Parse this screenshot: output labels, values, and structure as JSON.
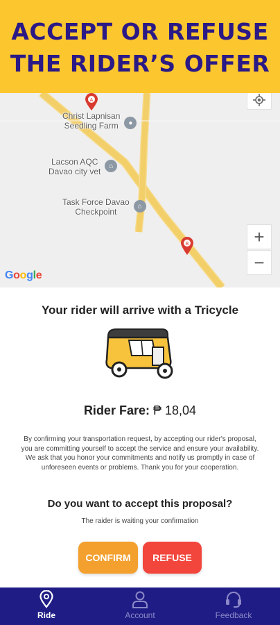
{
  "banner": {
    "line1": "ACCEPT OR REFUSE",
    "line2": "THE RIDER’S OFFER"
  },
  "map": {
    "pois": [
      {
        "name": "Christ Lapnisan\nSeedling Farm"
      },
      {
        "name": "Lacson AQC\nDavao city vet"
      },
      {
        "name": "Task Force Davao\nCheckpoint"
      }
    ],
    "marker_a": "A",
    "marker_b": "B",
    "zoom_in": "+",
    "zoom_out": "−",
    "logo": "Google"
  },
  "ride": {
    "arrive_text": "Your rider will arrive with a  Tricycle",
    "fare_label": "Rider Fare:",
    "fare_value": "₱ 18,04",
    "disclaimer": "By confirming your transportation request, by accepting our rider's proposal, you are committing yourself to accept the service and ensure your availability. We ask that you honor your commitments and notify us promptly in case of unforeseen events or problems. Thank you for your cooperation.",
    "question": "Do you want to accept this proposal?",
    "waiting": "The raider is waiting your confirmation",
    "confirm_label": "CONFIRM",
    "refuse_label": "REFUSE"
  },
  "nav": {
    "items": [
      {
        "label": "Ride",
        "icon": "location-pin-icon",
        "active": true
      },
      {
        "label": "Account",
        "icon": "person-icon",
        "active": false
      },
      {
        "label": "Feedback",
        "icon": "headset-icon",
        "active": false
      }
    ]
  },
  "colors": {
    "banner_bg": "#fcc72e",
    "banner_text": "#2b1a86",
    "road": "#f4d27a",
    "confirm": "#f3a02e",
    "refuse": "#f2453b",
    "nav_bg": "#1f1d85"
  }
}
